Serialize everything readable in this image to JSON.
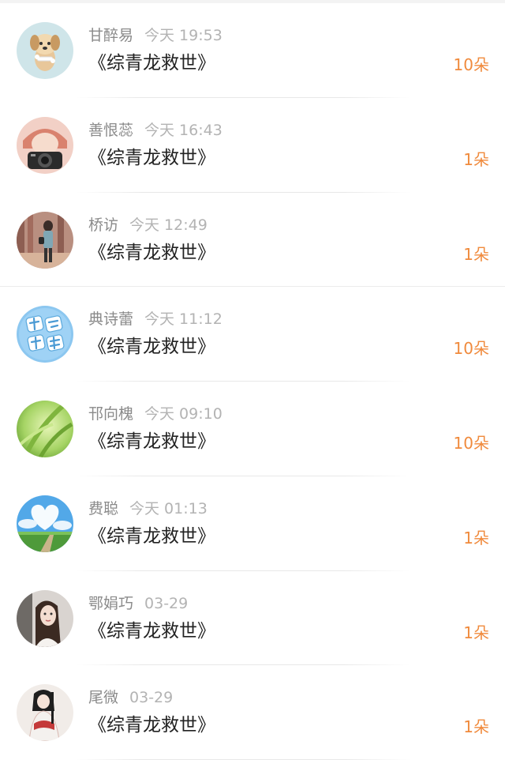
{
  "records": [
    {
      "name": "甘醉易",
      "time": "今天 19:53",
      "title": "《综青龙救世》",
      "amount": "10朵",
      "avatar_icon": "puppy-avatar-icon",
      "colors": {
        "bg": "#cfe5e9"
      }
    },
    {
      "name": "善恨蕊",
      "time": "今天 16:43",
      "title": "《综青龙救世》",
      "amount": "1朵",
      "avatar_icon": "camera-girl-avatar-icon",
      "colors": {
        "bg": "#f2d0c6"
      }
    },
    {
      "name": "桥访",
      "time": "今天 12:49",
      "title": "《综青龙救世》",
      "amount": "1朵",
      "avatar_icon": "forest-girl-avatar-icon",
      "colors": {
        "bg": "#b98f80"
      }
    },
    {
      "name": "典诗蕾",
      "time": "今天 11:12",
      "title": "《综青龙救世》",
      "amount": "10朵",
      "avatar_icon": "cheer-text-avatar-icon",
      "colors": {
        "bg": "#8cc7f0"
      }
    },
    {
      "name": "邗向槐",
      "time": "今天 09:10",
      "title": "《综青龙救世》",
      "amount": "10朵",
      "avatar_icon": "green-leaf-avatar-icon",
      "colors": {
        "bg": "#9ccc5e"
      }
    },
    {
      "name": "费聪",
      "time": "今天 01:13",
      "title": "《综青龙救世》",
      "amount": "1朵",
      "avatar_icon": "heart-sky-avatar-icon",
      "colors": {
        "bg": "#52a8e8"
      }
    },
    {
      "name": "鄂娟巧",
      "time": "03-29",
      "title": "《综青龙救世》",
      "amount": "1朵",
      "avatar_icon": "portrait-girl-avatar-icon",
      "colors": {
        "bg": "#d9d4d0"
      }
    },
    {
      "name": "尾微",
      "time": "03-29",
      "title": "《综青龙救世》",
      "amount": "1朵",
      "avatar_icon": "hanfu-girl-avatar-icon",
      "colors": {
        "bg": "#f1ece8"
      }
    }
  ],
  "colors": {
    "accent": "#f08a3c",
    "name_text": "#8a8a8a",
    "time_text": "#b3b3b3",
    "title_text": "#222222"
  }
}
